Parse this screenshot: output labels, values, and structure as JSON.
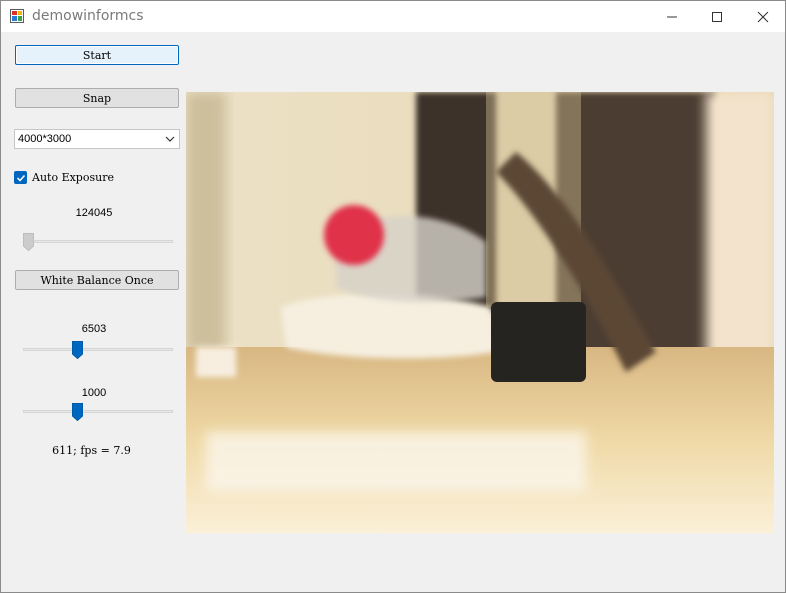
{
  "window": {
    "title": "demowinformcs",
    "app_icon": "winforms-app-icon",
    "controls": [
      "minimize-icon",
      "maximize-icon",
      "close-icon"
    ]
  },
  "controls": {
    "start_label": "Start",
    "snap_label": "Snap",
    "resolution_selected": "4000*3000",
    "auto_exposure_label": "Auto Exposure",
    "auto_exposure_checked": true,
    "exposure_value": "124045",
    "exposure_slider_fraction": 0.0,
    "white_balance_label": "White Balance Once",
    "wb_temp_value": "6503",
    "wb_temp_slider_fraction": 0.35,
    "wb_tint_value": "1000",
    "wb_tint_slider_fraction": 0.35,
    "status_text": "611; fps = 7.9"
  },
  "colors": {
    "accent": "#0067c0",
    "window_bg": "#f0f0f0"
  },
  "preview": {
    "label": "live-camera-preview-image"
  }
}
